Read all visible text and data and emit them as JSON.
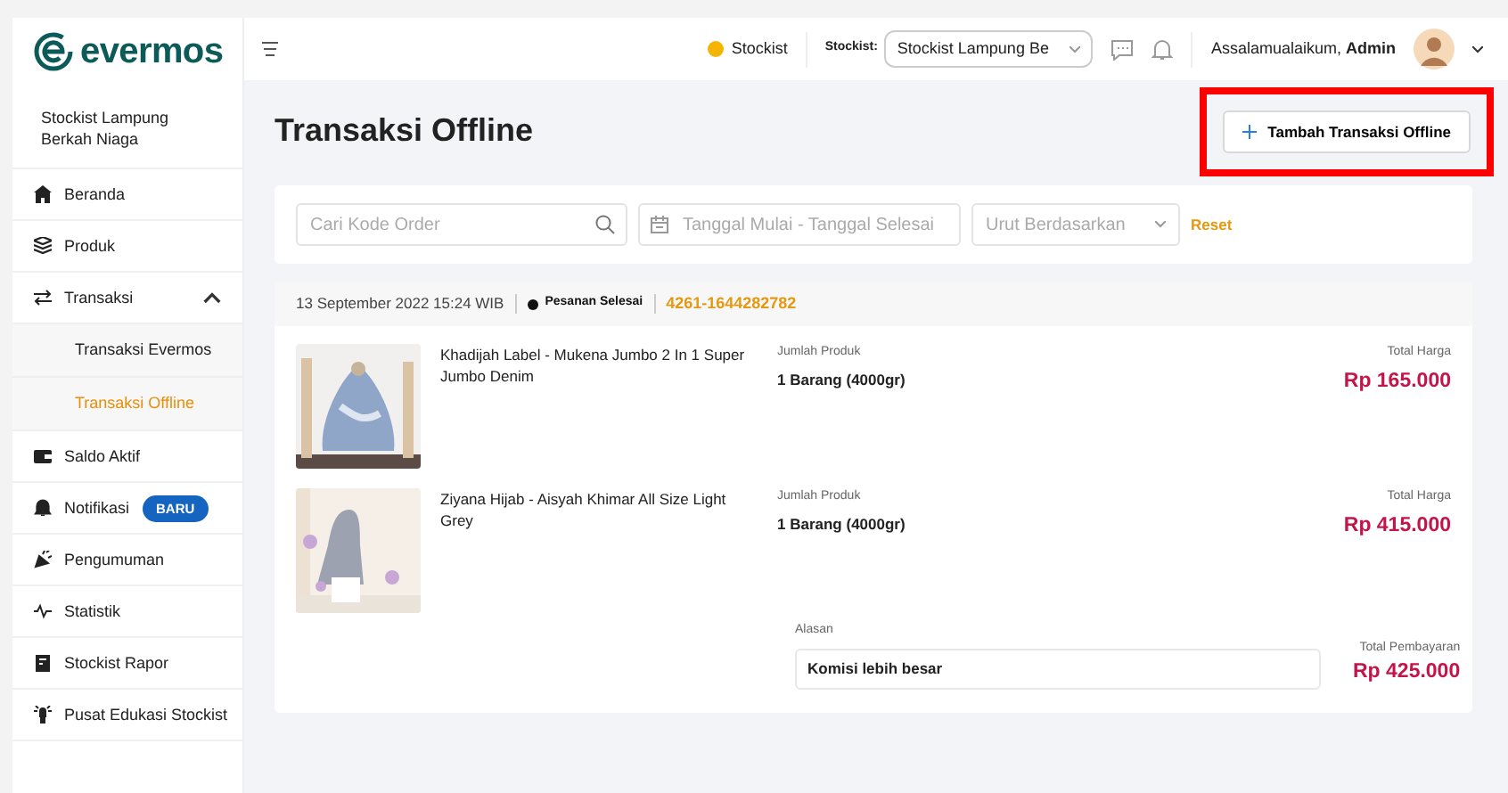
{
  "brand": {
    "name": "evermos"
  },
  "sidebar": {
    "store_name": "Stockist Lampung Berkah Niaga",
    "items": [
      {
        "label": "Beranda",
        "selected": false
      },
      {
        "label": "Produk",
        "selected": false
      },
      {
        "label": "Transaksi",
        "selected": false,
        "expanded": true,
        "children": [
          {
            "label": "Transaksi Evermos",
            "selected": false
          },
          {
            "label": "Transaksi Offline",
            "selected": true
          }
        ]
      },
      {
        "label": "Saldo Aktif",
        "selected": false
      },
      {
        "label": "Notifikasi",
        "selected": false,
        "badge": "BARU"
      },
      {
        "label": "Pengumuman",
        "selected": false
      },
      {
        "label": "Statistik",
        "selected": false
      },
      {
        "label": "Stockist Rapor",
        "selected": false
      },
      {
        "label": "Pusat Edukasi Stockist",
        "selected": false
      }
    ]
  },
  "topbar": {
    "role": "Stockist",
    "stockist_label": "Stockist:",
    "stockist_value": "Stockist Lampung Be",
    "greeting": "Assalamualaikum, **Admin**"
  },
  "page": {
    "title": "Transaksi Offline",
    "add_button": "Tambah Transaksi Offline",
    "highlighted": true
  },
  "filters": {
    "search": {
      "placeholder": "Cari Kode Order"
    },
    "date": {
      "placeholder": "Tanggal Mulai - Tanggal Selesai"
    },
    "sort": {
      "placeholder": "Urut Berdasarkan"
    },
    "reset": "Reset"
  },
  "orders": [
    {
      "date": "13 September 2022 15:24 WIB",
      "status": "Pesanan Selesai",
      "code": "4261-1644282782",
      "items": [
        {
          "name": "Khadijah Label - Mukena Jumbo 2 In 1 Super Jumbo Denim",
          "qty_label": "Jumlah Produk",
          "qty": "1 Barang (4000gr)",
          "total_label": "Total Harga",
          "total": "Rp 165.000",
          "kind": "picture"
        },
        {
          "name": "Ziyana Hijab - Aisyah Khimar All Size Light Grey",
          "qty_label": "Jumlah Produk",
          "qty": "1 Barang (4000gr)",
          "total_label": "Total Harga",
          "total": "Rp 415.000",
          "kind": "picture"
        }
      ],
      "reason_label": "Alasan",
      "reason": "Komisi lebih besar",
      "payment_label": "Total Pembayaran",
      "payment": "Rp 425.000"
    }
  ]
}
